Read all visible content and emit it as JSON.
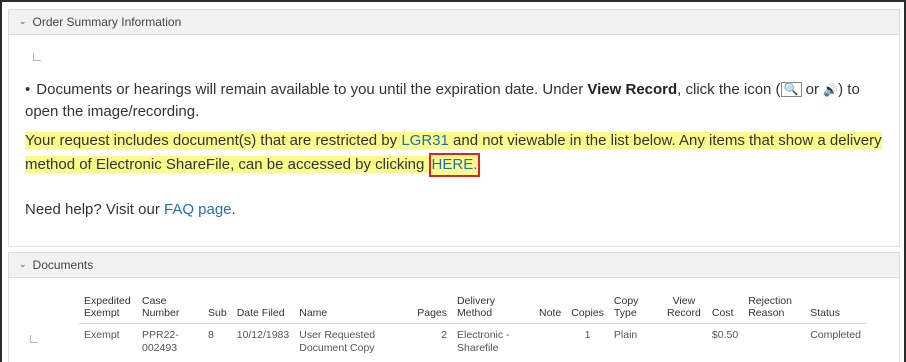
{
  "order_summary": {
    "header": "Order Summary Information",
    "bullet_text_before": "Documents or hearings will remain available to you until the expiration date. Under ",
    "bullet_bold": "View Record",
    "bullet_text_mid": ", click the icon (",
    "icon_glyph_1": "🔍",
    "icon_or": " or ",
    "icon_glyph_2": "🔊",
    "bullet_text_after": ") to open the image/recording.",
    "highlight_before": "Your request includes document(s) that are restricted by ",
    "lgr_link": "LGR31",
    "highlight_mid": " and not viewable in the list below. Any items that show a delivery method of Electronic ShareFile, can be accessed by clicking ",
    "here_link": "HERE.",
    "help_before": "Need help? Visit our ",
    "faq_link": "FAQ page",
    "help_after": "."
  },
  "documents": {
    "header": "Documents",
    "columns": {
      "expedited": "Expedited Exempt",
      "case_number": "Case Number",
      "sub": "Sub",
      "date_filed": "Date Filed",
      "name": "Name",
      "pages": "Pages",
      "delivery_method": "Delivery Method",
      "note": "Note",
      "copies": "Copies",
      "copy_type": "Copy Type",
      "view_record": "View Record",
      "cost": "Cost",
      "rejection_reason": "Rejection Reason",
      "status": "Status"
    },
    "rows": [
      {
        "expedited": "Exempt",
        "case_number": "PPR22-002493",
        "sub": "8",
        "date_filed": "10/12/1983",
        "name": "User Requested Document Copy",
        "pages": "2",
        "delivery_method": "Electronic - Sharefile",
        "note": "",
        "copies": "1",
        "copy_type": "Plain",
        "view_record": "",
        "cost": "$0.50",
        "rejection_reason": "",
        "status": "Completed"
      }
    ]
  }
}
